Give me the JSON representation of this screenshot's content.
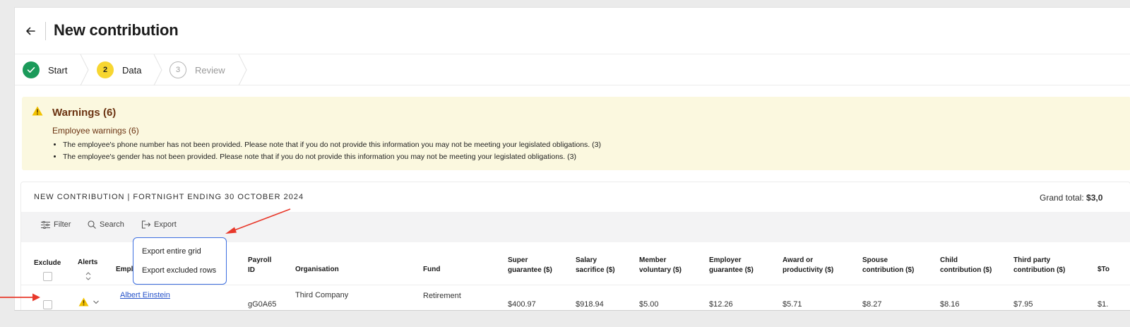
{
  "header": {
    "title": "New contribution"
  },
  "steps": [
    {
      "number": "",
      "label": "Start",
      "state": "done"
    },
    {
      "number": "2",
      "label": "Data",
      "state": "current"
    },
    {
      "number": "3",
      "label": "Review",
      "state": "upcoming"
    }
  ],
  "warnings": {
    "title": "Warnings (6)",
    "subtitle": "Employee warnings (6)",
    "items": [
      "The employee's phone number has not been provided. Please note that if you do not provide this information you may not be meeting your legislated obligations. (3)",
      "The employee's gender has not been provided. Please note that if you do not provide this information you may not be meeting your legislated obligations. (3)"
    ]
  },
  "grid": {
    "heading": "NEW CONTRIBUTION | FORTNIGHT ENDING 30 OCTOBER 2024",
    "grand_total_label": "Grand total:",
    "grand_total_value": "$3,0",
    "toolbar": {
      "filter": "Filter",
      "search": "Search",
      "export": "Export"
    },
    "columns": {
      "exclude": "Exclude",
      "alerts": "Alerts",
      "employee": "Emplo",
      "payroll_1": "Payroll",
      "payroll_2": "ID",
      "organisation": "Organisation",
      "fund": "Fund",
      "super_1": "Super",
      "super_2": "guarantee ($)",
      "salary_1": "Salary",
      "salary_2": "sacrifice ($)",
      "member_1": "Member",
      "member_2": "voluntary ($)",
      "employer_1": "Employer",
      "employer_2": "guarantee ($)",
      "award_1": "Award or",
      "award_2": "productivity ($)",
      "spouse_1": "Spouse",
      "spouse_2": "contribution ($)",
      "child_1": "Child",
      "child_2": "contribution ($)",
      "third_1": "Third party",
      "third_2": "contribution ($)",
      "total": "$To"
    },
    "row": {
      "employee": "Albert Einstein",
      "payroll": "gG0A65",
      "organisation": "Third Company",
      "fund": "Retirement",
      "super": "$400.97",
      "salary": "$918.94",
      "member": "$5.00",
      "employer": "$12.26",
      "award": "$5.71",
      "spouse": "$8.27",
      "child": "$8.16",
      "third": "$7.95",
      "total": "$1."
    }
  },
  "export_menu": {
    "entire_grid": "Export entire grid",
    "excluded_rows": "Export excluded rows"
  },
  "colors": {
    "accent_yellow": "#f7d631",
    "success": "#1b9a5a",
    "annotation": "#e8392b",
    "menu_border": "#3d6fe0"
  }
}
